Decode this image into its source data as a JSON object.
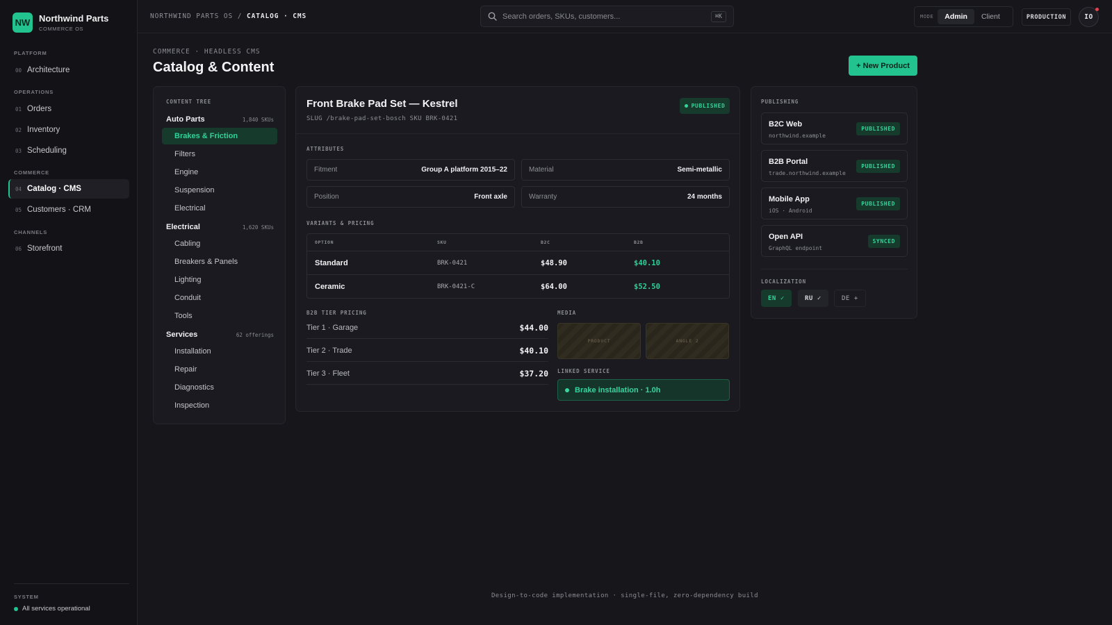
{
  "brand": {
    "logo": "NW",
    "name": "Northwind Parts",
    "sub": "COMMERCE OS"
  },
  "sidebar": {
    "sections": [
      {
        "label": "PLATFORM",
        "items": [
          {
            "num": "00",
            "label": "Architecture"
          }
        ]
      },
      {
        "label": "OPERATIONS",
        "items": [
          {
            "num": "01",
            "label": "Orders"
          },
          {
            "num": "02",
            "label": "Inventory"
          },
          {
            "num": "03",
            "label": "Scheduling"
          }
        ]
      },
      {
        "label": "COMMERCE",
        "items": [
          {
            "num": "04",
            "label": "Catalog · CMS"
          },
          {
            "num": "05",
            "label": "Customers · CRM"
          }
        ]
      },
      {
        "label": "CHANNELS",
        "items": [
          {
            "num": "06",
            "label": "Storefront"
          }
        ]
      }
    ],
    "system_label": "SYSTEM",
    "system_status": "All services operational"
  },
  "topbar": {
    "crumb_root": "NORTHWIND PARTS OS",
    "crumb_sep": "/",
    "crumb_current": "CATALOG · CMS",
    "search_placeholder": "Search orders, SKUs, customers...",
    "search_kbd": "⌘K",
    "mode_label": "MODE",
    "mode_admin": "Admin",
    "mode_client": "Client",
    "environment": "PRODUCTION",
    "avatar": "IO"
  },
  "header": {
    "eyebrow": "COMMERCE · HEADLESS CMS",
    "title": "Catalog & Content",
    "new_button": "+ New Product"
  },
  "tree": {
    "title": "CONTENT TREE",
    "groups": [
      {
        "label": "Auto Parts",
        "count": "1,840 SKUs",
        "items": [
          "Brakes & Friction",
          "Filters",
          "Engine",
          "Suspension",
          "Electrical"
        ]
      },
      {
        "label": "Electrical",
        "count": "1,620 SKUs",
        "items": [
          "Cabling",
          "Breakers & Panels",
          "Lighting",
          "Conduit",
          "Tools"
        ]
      },
      {
        "label": "Services",
        "count": "62 offerings",
        "items": [
          "Installation",
          "Repair",
          "Diagnostics",
          "Inspection"
        ]
      }
    ]
  },
  "product": {
    "title": "Front Brake Pad Set — Kestrel",
    "meta": "SLUG /brake-pad-set-bosch   SKU BRK-0421",
    "status": "PUBLISHED",
    "attributes_label": "ATTRIBUTES",
    "attributes": [
      {
        "key": "Fitment",
        "value": "Group A platform 2015–22"
      },
      {
        "key": "Material",
        "value": "Semi-metallic"
      },
      {
        "key": "Position",
        "value": "Front axle"
      },
      {
        "key": "Warranty",
        "value": "24 months"
      }
    ],
    "variants_label": "VARIANTS & PRICING",
    "variant_headers": [
      "OPTION",
      "SKU",
      "B2C",
      "B2B"
    ],
    "variants": [
      {
        "option": "Standard",
        "sku": "BRK-0421",
        "b2c": "$48.90",
        "b2b": "$40.10"
      },
      {
        "option": "Ceramic",
        "sku": "BRK-0421-C",
        "b2c": "$64.00",
        "b2b": "$52.50"
      }
    ],
    "tier_label": "B2B TIER PRICING",
    "tiers": [
      {
        "name": "Tier 1 · Garage",
        "price": "$44.00"
      },
      {
        "name": "Tier 2 · Trade",
        "price": "$40.10"
      },
      {
        "name": "Tier 3 · Fleet",
        "price": "$37.20"
      }
    ],
    "media_label": "MEDIA",
    "media": [
      "PRODUCT",
      "ANGLE 2"
    ],
    "linked_label": "LINKED SERVICE",
    "linked_service": "Brake installation · 1.0h"
  },
  "publishing": {
    "label": "PUBLISHING",
    "channels": [
      {
        "name": "B2C Web",
        "sub": "northwind.example",
        "status": "PUBLISHED"
      },
      {
        "name": "B2B Portal",
        "sub": "trade.northwind.example",
        "status": "PUBLISHED"
      },
      {
        "name": "Mobile App",
        "sub": "iOS · Android",
        "status": "PUBLISHED"
      },
      {
        "name": "Open API",
        "sub": "GraphQL endpoint",
        "status": "SYNCED"
      }
    ],
    "localization_label": "LOCALIZATION",
    "locales": [
      {
        "code": "EN",
        "mark": "✓"
      },
      {
        "code": "RU",
        "mark": "✓"
      },
      {
        "code": "DE",
        "mark": "+"
      }
    ]
  },
  "footer": "Design-to-code implementation · single-file, zero-dependency build",
  "colors": {
    "accent": "#22c38e",
    "background": "#16161b",
    "panel": "#1a1a20",
    "badge_bg": "#163a2c",
    "alert": "#e0444f"
  }
}
